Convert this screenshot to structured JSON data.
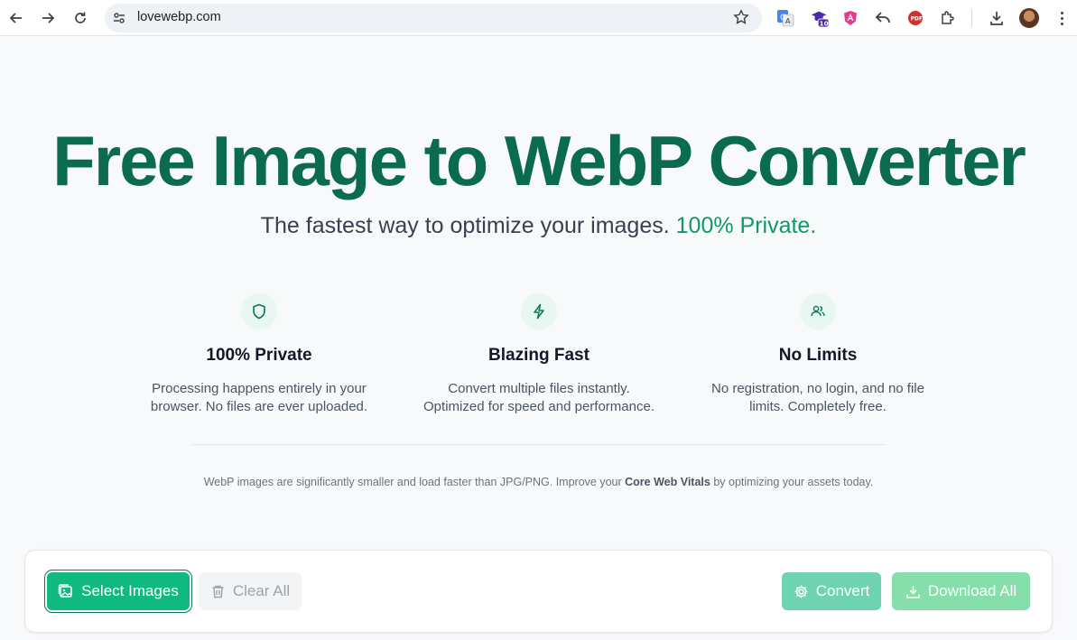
{
  "browser": {
    "url": "lovewebp.com",
    "extension_badge": "10"
  },
  "hero": {
    "title": "Free Image to WebP Converter",
    "subtitle": "The fastest way to optimize your images.",
    "subtitle_accent": "100% Private."
  },
  "features": [
    {
      "icon": "shield-icon",
      "title": "100% Private",
      "description": "Processing happens entirely in your browser. No files are ever uploaded."
    },
    {
      "icon": "lightning-icon",
      "title": "Blazing Fast",
      "description": "Convert multiple files instantly. Optimized for speed and performance."
    },
    {
      "icon": "users-icon",
      "title": "No Limits",
      "description": "No registration, no login, and no file limits. Completely free."
    }
  ],
  "note": {
    "before": "WebP images are significantly smaller and load faster than JPG/PNG. Improve your",
    "strong": "Core Web Vitals",
    "after": "by optimizing your assets today."
  },
  "toolbar": {
    "select_label": "Select Images",
    "clear_label": "Clear All",
    "convert_label": "Convert",
    "download_label": "Download All"
  },
  "colors": {
    "brand_dark": "#0b6b4f",
    "brand": "#10b981",
    "accent_text": "#0f9a63"
  }
}
